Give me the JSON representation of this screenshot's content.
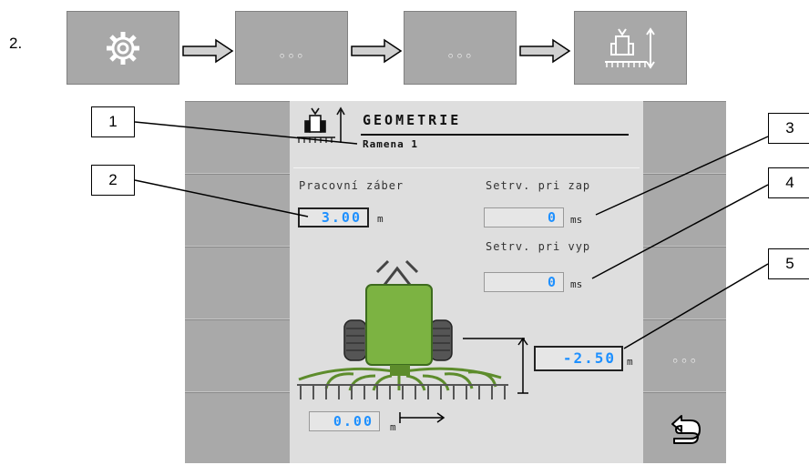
{
  "step_number": "2.",
  "flow": {
    "dots_label": "◦◦◦",
    "icons": [
      "gear-icon",
      "more-icon",
      "more-icon",
      "boom-geometry-icon"
    ]
  },
  "screen": {
    "title": "GEOMETRIE",
    "subtitle": "Ramena 1",
    "working_width": {
      "label": "Pracovní záber",
      "value": "3.00",
      "unit": "m"
    },
    "delay_on": {
      "label": "Setrv. pri zap",
      "value": "0",
      "unit": "ms"
    },
    "delay_off": {
      "label": "Setrv. pri vyp",
      "value": "0",
      "unit": "ms"
    },
    "boom_height": {
      "value": "-2.50",
      "unit": "m"
    },
    "lateral_offset": {
      "value": "0.00",
      "unit": "m"
    }
  },
  "side_menu": {
    "more_label": "◦◦◦",
    "back_icon": "return-arrow-icon"
  },
  "callouts": [
    "1",
    "2",
    "3",
    "4",
    "5"
  ],
  "colors": {
    "value_text": "#1e90ff",
    "machine_green": "#7cb342",
    "flow_box": "#a8a8a8"
  }
}
